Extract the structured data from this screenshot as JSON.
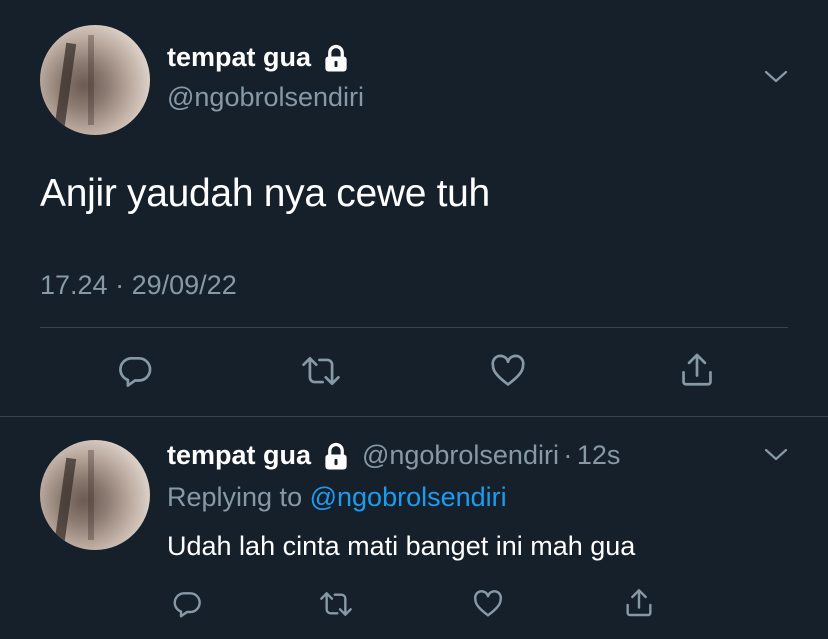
{
  "main_tweet": {
    "display_name": "tempat gua",
    "handle": "@ngobrolsendiri",
    "text": "Anjir yaudah nya cewe tuh",
    "time": "17.24",
    "separator": "·",
    "date": "29/09/22"
  },
  "reply_tweet": {
    "display_name": "tempat gua",
    "handle": "@ngobrolsendiri",
    "dot": "·",
    "age": "12s",
    "replying_to_label": "Replying to",
    "replying_to_handle": "@ngobrolsendiri",
    "text": "Udah lah cinta mati banget ini mah gua"
  },
  "icons": {
    "lock": "lock-icon",
    "more": "chevron-down-icon",
    "reply": "comment-bubble-icon",
    "retweet": "retweet-icon",
    "like": "heart-icon",
    "share": "share-upload-icon"
  },
  "colors": {
    "background": "#15202b",
    "text": "#ffffff",
    "secondary": "#8899a6",
    "link": "#1d9bf0",
    "divider": "#38444d"
  }
}
